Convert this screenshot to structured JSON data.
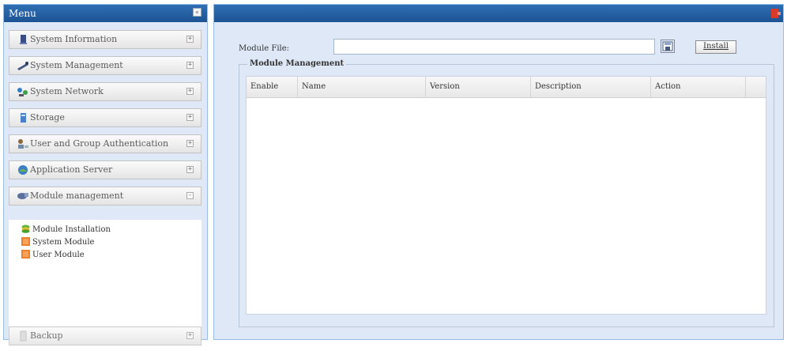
{
  "menu": {
    "title": "Menu",
    "collapse_glyph": "«",
    "items": [
      {
        "label": "System Information",
        "icon": "system-information-icon",
        "toggle": "+"
      },
      {
        "label": "System Management",
        "icon": "system-management-icon",
        "toggle": "+"
      },
      {
        "label": "System Network",
        "icon": "system-network-icon",
        "toggle": "+"
      },
      {
        "label": "Storage",
        "icon": "storage-icon",
        "toggle": "+"
      },
      {
        "label": "User and Group Authentication",
        "icon": "user-group-icon",
        "toggle": "+"
      },
      {
        "label": "Application Server",
        "icon": "application-server-icon",
        "toggle": "+"
      },
      {
        "label": "Module management",
        "icon": "module-management-icon",
        "toggle": "-"
      }
    ],
    "submenu": [
      {
        "label": "Module Installation",
        "icon": "module-installation-icon"
      },
      {
        "label": "System Module",
        "icon": "system-module-icon"
      },
      {
        "label": "User Module",
        "icon": "user-module-icon"
      }
    ],
    "backup": {
      "label": "Backup",
      "icon": "backup-icon",
      "toggle": "+"
    }
  },
  "content": {
    "file_label": "Module File:",
    "file_value": "",
    "install_label": "Install",
    "fieldset_legend": "Module Management",
    "columns": [
      "Enable",
      "Name",
      "Version",
      "Description",
      "Action"
    ]
  },
  "colors": {
    "header_blue": "#1f5a9e",
    "panel_bg": "#dfe8f6",
    "logout_red": "#d93a2a"
  }
}
